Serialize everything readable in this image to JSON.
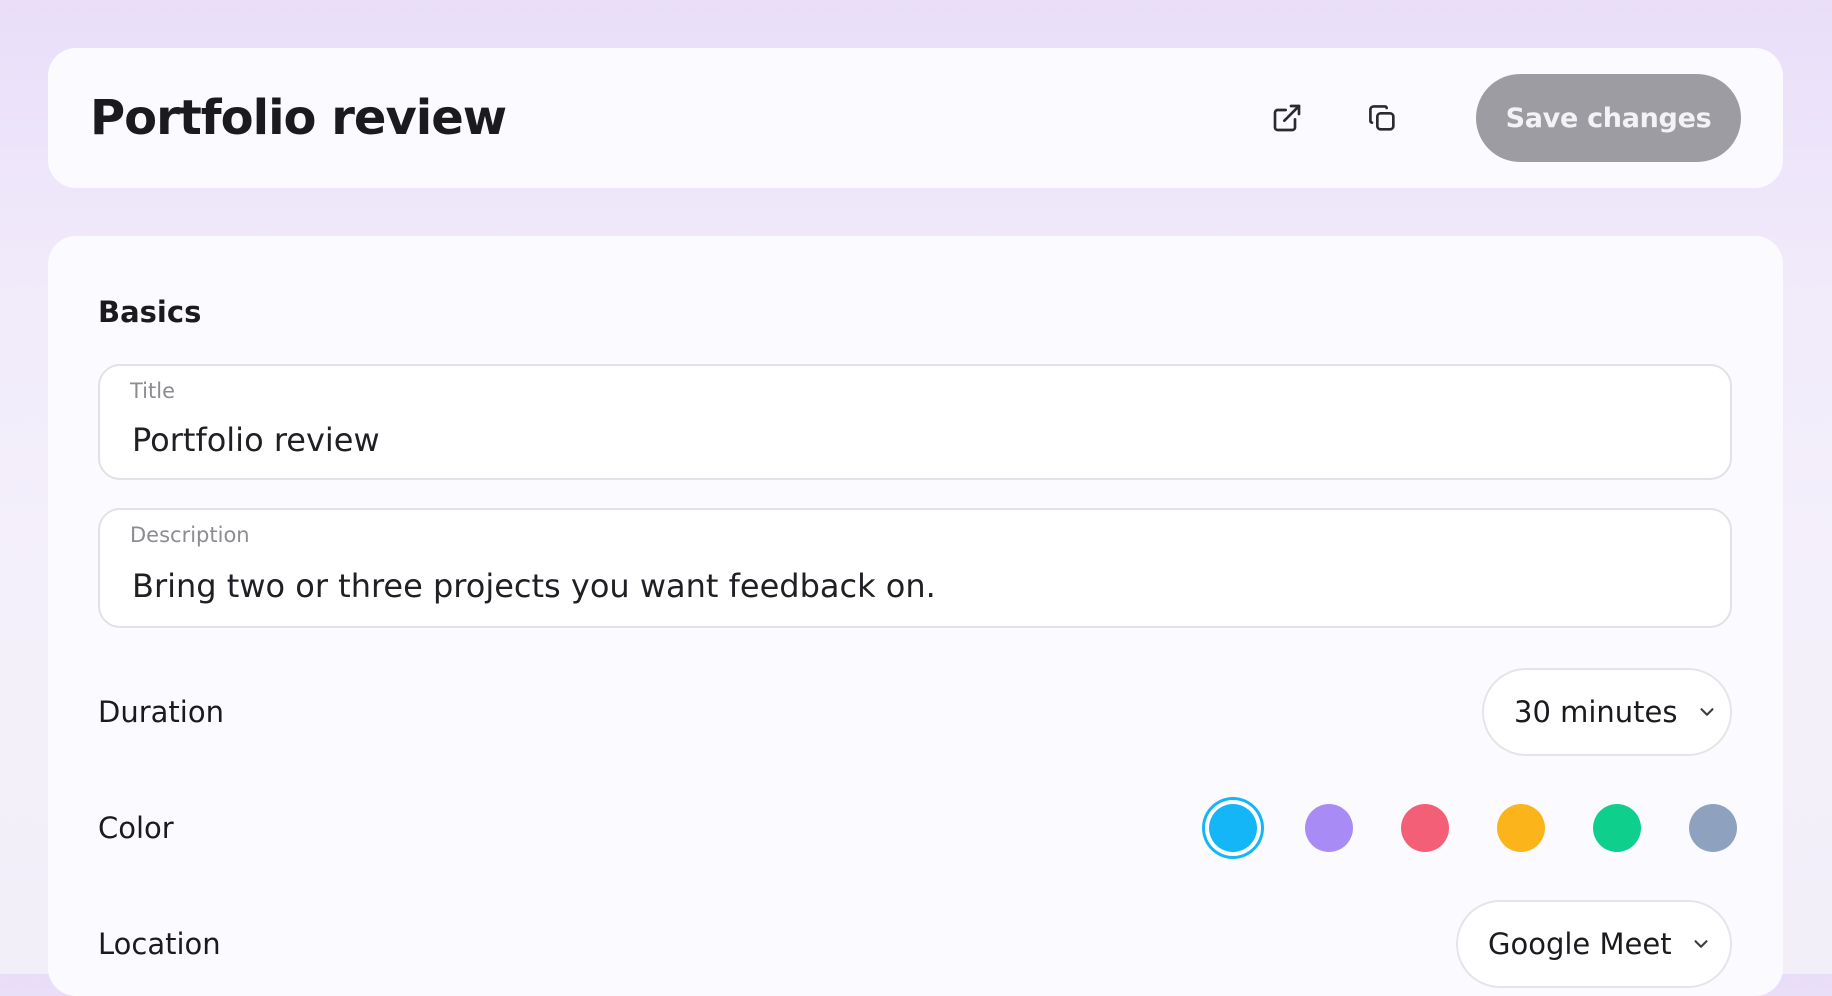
{
  "header": {
    "title": "Portfolio review",
    "open_icon": "external-link-icon",
    "copy_icon": "copy-icon",
    "save_label": "Save changes"
  },
  "basics": {
    "section_title": "Basics",
    "title_field": {
      "label": "Title",
      "value": "Portfolio review"
    },
    "description_field": {
      "label": "Description",
      "value": "Bring two or three projects you want feedback on."
    },
    "duration": {
      "label": "Duration",
      "value": "30 minutes"
    },
    "color": {
      "label": "Color",
      "selected": "#15b6f7",
      "options": [
        "#15b6f7",
        "#a98bf5",
        "#f45f78",
        "#fbb51a",
        "#0fcf8c",
        "#8ea2bf"
      ]
    },
    "location": {
      "label": "Location",
      "value": "Google Meet"
    }
  }
}
